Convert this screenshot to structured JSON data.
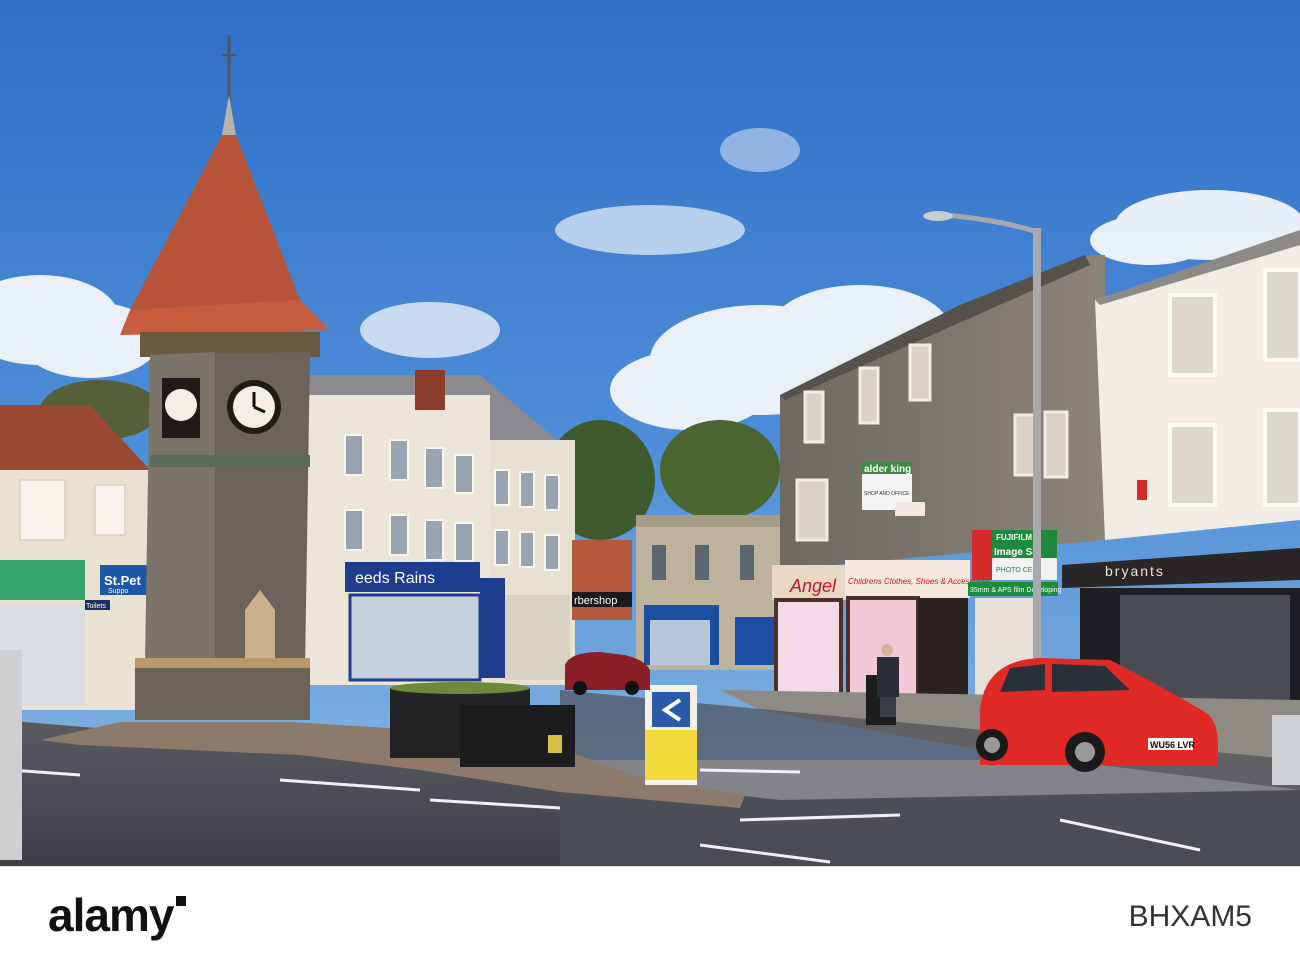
{
  "photo": {
    "description_tag": "town-square-clock-tower",
    "signs": {
      "st_peters": "St.Pet",
      "st_peters_sub": "Suppo",
      "toilets": "Toilets",
      "reeds_rains": "eeds Rains",
      "barbershop": "rbershop",
      "alder_king": "alder king",
      "alder_king_sub": "SHOP AND OFFICE",
      "angel": "Angel",
      "childrens": "Childrens Clothes, Shoes & Accessories",
      "fujifilm": "FUJIFILM",
      "image_service": "Image Se",
      "photo_centre": "PHOTO CEN",
      "developing": "35mm & APS film Developing",
      "bryants": "bryants",
      "plate": "WU56 LVR"
    }
  },
  "footer": {
    "logo": "alamy",
    "image_id": "BHXAM5"
  }
}
